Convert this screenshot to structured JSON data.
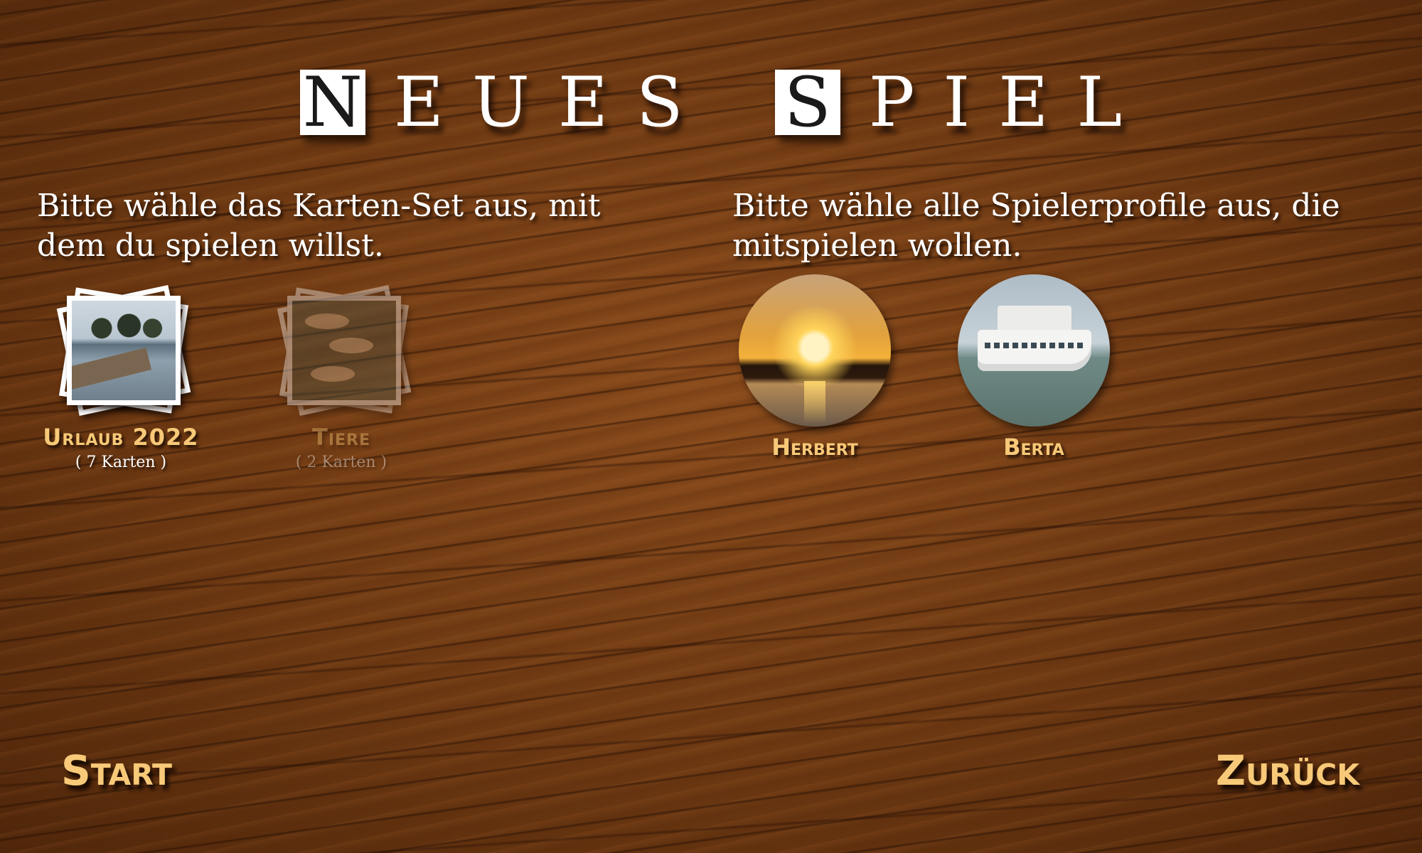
{
  "title": {
    "words": [
      {
        "first": "N",
        "rest": [
          "E",
          "U",
          "E",
          "S"
        ]
      },
      {
        "first": "S",
        "rest": [
          "P",
          "I",
          "E",
          "L"
        ]
      }
    ]
  },
  "card_sets": {
    "instruction": "Bitte wähle das Karten-Set aus, mit dem du spielen willst.",
    "items": [
      {
        "name": "Urlaub 2022",
        "count": "( 7 Karten )",
        "selected": true,
        "thumbnail": "lake-pier-photo"
      },
      {
        "name": "Tiere",
        "count": "( 2 Karten )",
        "selected": false,
        "thumbnail": "fish-photo"
      }
    ]
  },
  "players": {
    "instruction": "Bitte wähle alle Spielerprofile aus, die mitspielen wollen.",
    "items": [
      {
        "name": "Herbert",
        "avatar": "sunset-photo"
      },
      {
        "name": "Berta",
        "avatar": "ship-photo"
      }
    ]
  },
  "actions": {
    "start_label": "Start",
    "back_label": "Zurück"
  },
  "colors": {
    "accent": "#f7c978",
    "text": "#ffffff",
    "background": "#6b3a14"
  }
}
